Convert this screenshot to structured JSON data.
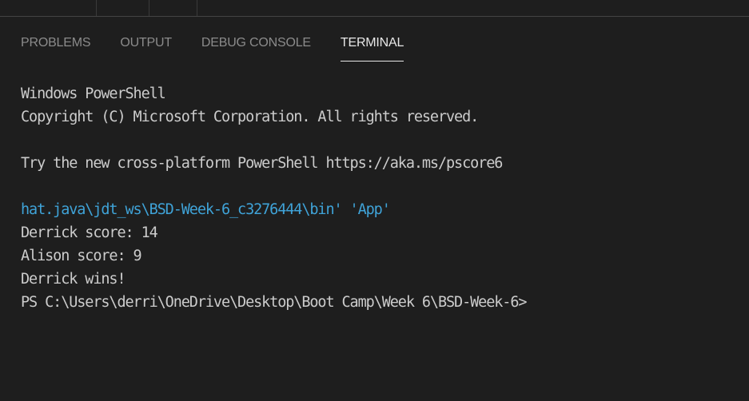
{
  "panel_tabs": [
    {
      "label": "PROBLEMS",
      "active": false
    },
    {
      "label": "OUTPUT",
      "active": false
    },
    {
      "label": "DEBUG CONSOLE",
      "active": false
    },
    {
      "label": "TERMINAL",
      "active": true
    }
  ],
  "terminal": {
    "lines": [
      {
        "text": "Windows PowerShell",
        "style": "normal"
      },
      {
        "text": "Copyright (C) Microsoft Corporation. All rights reserved.",
        "style": "normal"
      },
      {
        "text": "",
        "style": "normal"
      },
      {
        "text": "Try the new cross-platform PowerShell https://aka.ms/pscore6",
        "style": "normal"
      },
      {
        "text": "",
        "style": "normal"
      },
      {
        "text": "hat.java\\jdt_ws\\BSD-Week-6_c3276444\\bin' 'App'",
        "style": "highlight"
      },
      {
        "text": "Derrick score: 14",
        "style": "normal"
      },
      {
        "text": "Alison score: 9",
        "style": "normal"
      },
      {
        "text": "Derrick wins!",
        "style": "normal"
      },
      {
        "text": "PS C:\\Users\\derri\\OneDrive\\Desktop\\Boot Camp\\Week 6\\BSD-Week-6>",
        "style": "normal"
      }
    ]
  },
  "colors": {
    "background": "#1e1e1e",
    "tab_active": "#e7e7e7",
    "tab_inactive": "#8b8b8b",
    "terminal_text": "#cccccc",
    "terminal_highlight": "#3fa3d8"
  }
}
